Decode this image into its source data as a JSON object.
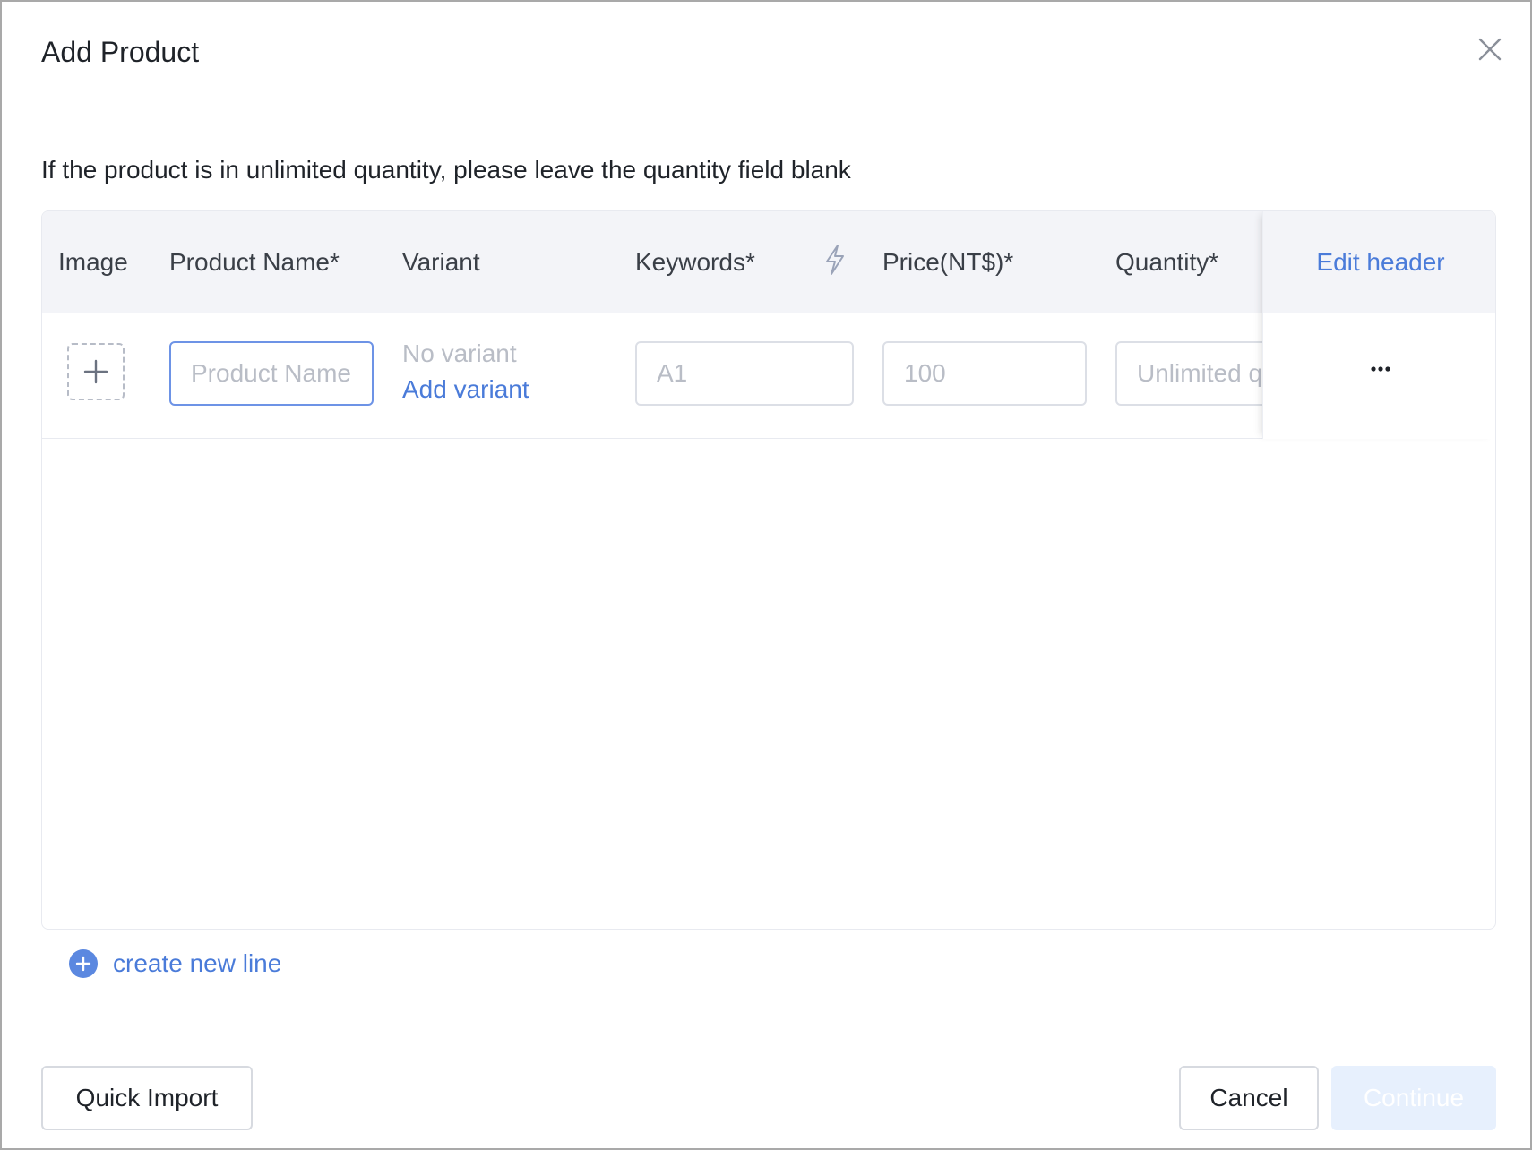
{
  "dialog": {
    "title": "Add Product",
    "hint": "If the product is in unlimited quantity, please leave the quantity field blank"
  },
  "table": {
    "headers": {
      "image": "Image",
      "product_name": "Product Name*",
      "variant": "Variant",
      "keywords": "Keywords*",
      "price": "Price(NT$)*",
      "quantity": "Quantity*",
      "edit_header": "Edit header"
    },
    "row": {
      "product_name_placeholder": "Product Name",
      "product_name_value": "",
      "variant_status": "No variant",
      "add_variant_label": "Add variant",
      "keywords_placeholder": "A1",
      "price_placeholder": "100",
      "quantity_placeholder": "Unlimited quantity"
    }
  },
  "actions": {
    "create_new_line": "create new line",
    "quick_import": "Quick Import",
    "cancel": "Cancel",
    "continue": "Continue"
  },
  "colors": {
    "accent": "#4a7bd9",
    "header_bg": "#f3f4f8",
    "continue_disabled_bg": "#e7f0fd"
  },
  "icons": {
    "close": "close-icon",
    "bolt": "lightning-icon",
    "upload": "plus-icon",
    "more": "more-horizontal-icon",
    "add": "plus-circle-icon"
  }
}
